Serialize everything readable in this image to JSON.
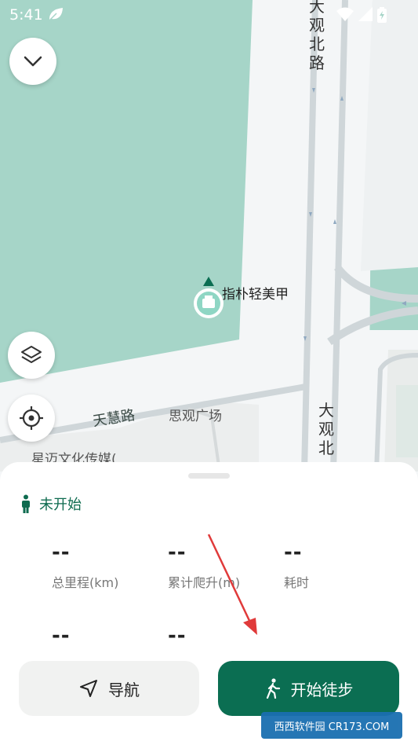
{
  "status_bar": {
    "time": "5:41"
  },
  "map": {
    "road_labels": {
      "daguan_north_top": [
        "大",
        "观",
        "北",
        "路"
      ],
      "daguan_north_bottom": [
        "大",
        "观",
        "北"
      ],
      "tianhui_road": "天慧路",
      "siguan_plaza": "思观广场",
      "xingmai": "星迈文化传媒("
    },
    "poi_name": "指朴轻美甲"
  },
  "panel": {
    "status": "未开始",
    "stats": [
      {
        "value": "--",
        "label": "总里程(km)"
      },
      {
        "value": "--",
        "label": "累计爬升(m)"
      },
      {
        "value": "--",
        "label": "耗时"
      },
      {
        "value": "--",
        "label": ""
      },
      {
        "value": "--",
        "label": ""
      }
    ],
    "nav_button": "导航",
    "start_button": "开始徒步"
  },
  "watermark": "西西软件园 CR173.COM",
  "colors": {
    "accent": "#0b6e52",
    "park": "#a6d5c8",
    "road": "#ffffff"
  }
}
